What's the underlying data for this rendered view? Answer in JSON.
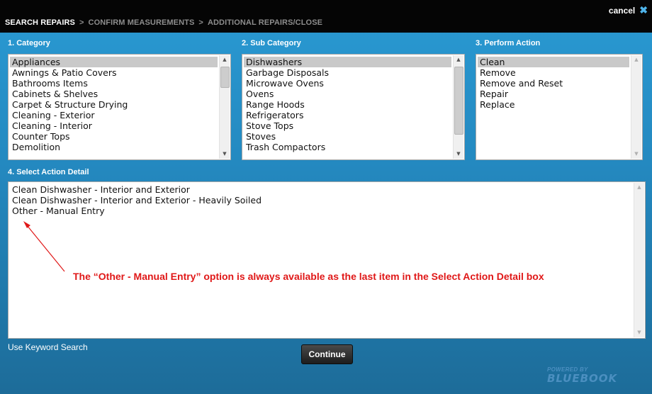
{
  "header": {
    "cancel_label": "cancel",
    "cancel_icon": "close-x-icon",
    "breadcrumb": [
      {
        "label": "SEARCH REPAIRS",
        "active": true
      },
      {
        "label": "CONFIRM MEASUREMENTS",
        "active": false
      },
      {
        "label": "ADDITIONAL REPAIRS/CLOSE",
        "active": false
      }
    ],
    "separator": ">"
  },
  "category": {
    "label": "1. Category",
    "items": [
      "Appliances",
      "Awnings & Patio Covers",
      "Bathrooms Items",
      "Cabinets & Shelves",
      "Carpet & Structure Drying",
      "Cleaning - Exterior",
      "Cleaning - Interior",
      "Counter Tops",
      "Demolition"
    ],
    "selected": "Appliances"
  },
  "sub_category": {
    "label": "2. Sub Category",
    "items": [
      "Dishwashers",
      "Garbage Disposals",
      "Microwave Ovens",
      "Ovens",
      "Range Hoods",
      "Refrigerators",
      "Stove Tops",
      "Stoves",
      "Trash Compactors"
    ],
    "selected": "Dishwashers"
  },
  "perform_action": {
    "label": "3. Perform Action",
    "items": [
      "Clean",
      "Remove",
      "Remove and Reset",
      "Repair",
      "Replace"
    ],
    "selected": "Clean"
  },
  "action_detail": {
    "label": "4. Select Action Detail",
    "items": [
      "Clean Dishwasher - Interior and Exterior",
      "Clean Dishwasher - Interior and Exterior - Heavily Soiled",
      "Other - Manual Entry"
    ]
  },
  "annotation": {
    "text": "The “Other - Manual Entry” option is always available as the last item in the Select Action Detail box",
    "color": "#e01818"
  },
  "footer": {
    "keyword_search": "Use Keyword Search",
    "continue_label": "Continue",
    "logo_powered": "POWERED BY",
    "logo_brand": "BLUEBOOK"
  },
  "colors": {
    "topbar": "#050505",
    "panel_blue": "#2489c0",
    "selection": "#c9c9c9"
  }
}
